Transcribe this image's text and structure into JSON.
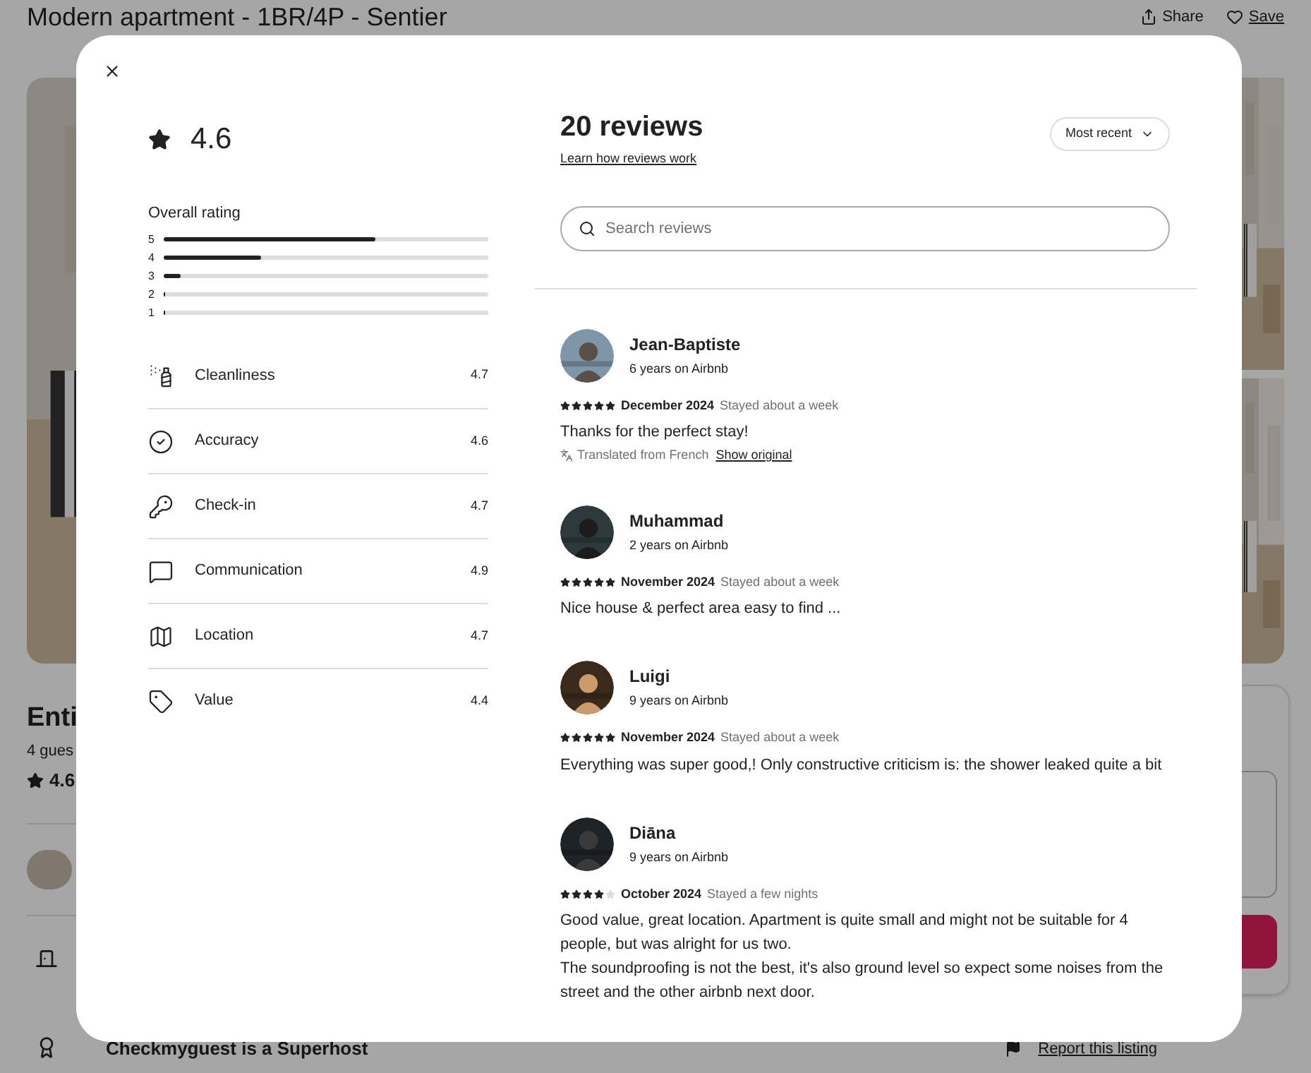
{
  "listing": {
    "title": "Modern apartment - 1BR/4P - Sentier",
    "share": "Share",
    "save": "Save",
    "heading": "Enti",
    "guests": "4 gues",
    "rating": "4.6",
    "host_line": "Checkmyguest is a Superhost",
    "report": "Report this listing"
  },
  "modal": {
    "rating": "4.6",
    "overall_title": "Overall rating",
    "distribution": [
      {
        "label": "5",
        "level": 0.65
      },
      {
        "label": "4",
        "level": 0.3
      },
      {
        "label": "3",
        "level": 0.05
      },
      {
        "label": "2",
        "level": 0
      },
      {
        "label": "1",
        "level": 0
      }
    ],
    "categories": [
      {
        "name": "Cleanliness",
        "score": "4.7"
      },
      {
        "name": "Accuracy",
        "score": "4.6"
      },
      {
        "name": "Check-in",
        "score": "4.7"
      },
      {
        "name": "Communication",
        "score": "4.9"
      },
      {
        "name": "Location",
        "score": "4.7"
      },
      {
        "name": "Value",
        "score": "4.4"
      }
    ],
    "reviews_title": "20 reviews",
    "learn_link": "Learn how reviews work",
    "sort": "Most recent",
    "search": {
      "placeholder": "Search reviews"
    },
    "reviews": [
      {
        "name": "Jean-Baptiste",
        "tenure": "6 years on Airbnb",
        "stars": 5,
        "date": "December 2024",
        "stay": "Stayed about a week",
        "text": "Thanks for the perfect stay!",
        "translation": "Translated from French",
        "translation_link": "Show original"
      },
      {
        "name": "Muhammad",
        "tenure": "2 years on Airbnb",
        "stars": 5,
        "date": "November 2024",
        "stay": "Stayed about a week",
        "text": "Nice house & perfect area easy to find ..."
      },
      {
        "name": "Luigi",
        "tenure": "9 years on Airbnb",
        "stars": 5,
        "date": "November 2024",
        "stay": "Stayed about a week",
        "text": "Everything was super good,! Only constructive criticism is: the shower leaked quite a bit"
      },
      {
        "name": "Diāna",
        "tenure": "9 years on Airbnb",
        "stars": 4,
        "date": "October 2024",
        "stay": "Stayed a few nights",
        "text": "Good value, great location. Apartment is quite small and might not be suitable for 4 people, but was alright for us two.\nThe soundproofing is not the best, it's also ground level so expect some noises from the street and the other airbnb next door."
      }
    ]
  }
}
